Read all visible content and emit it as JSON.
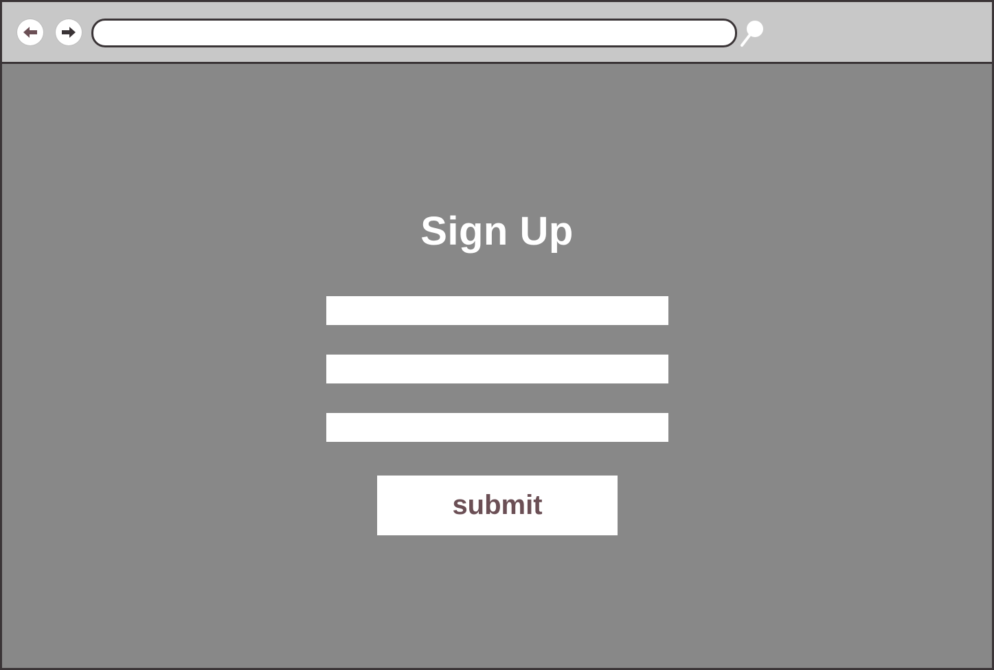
{
  "browser": {
    "icons": {
      "back": "arrow-left-icon",
      "forward": "arrow-right-icon",
      "search": "magnifier-icon"
    },
    "address_value": ""
  },
  "form": {
    "title": "Sign Up",
    "fields": [
      {
        "value": "",
        "placeholder": ""
      },
      {
        "value": "",
        "placeholder": ""
      },
      {
        "value": "",
        "placeholder": ""
      }
    ],
    "submit_label": "submit"
  },
  "colors": {
    "toolbar_bg": "#c8c8c8",
    "page_bg": "#888888",
    "border": "#3a3436",
    "submit_text": "#6b4f55"
  }
}
